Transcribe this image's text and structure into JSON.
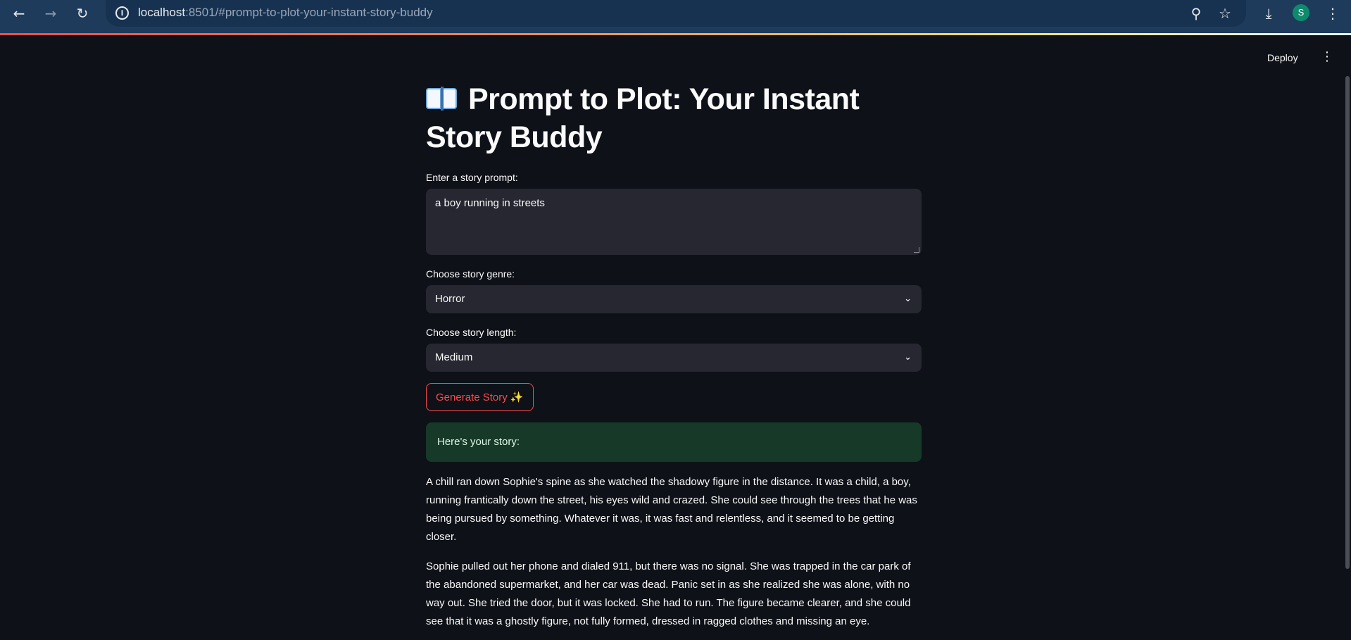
{
  "browser": {
    "url_host": "localhost",
    "url_path": ":8501/#prompt-to-plot-your-instant-story-buddy",
    "profile_initial": "S",
    "icons": [
      "back-arrow-icon",
      "forward-arrow-icon",
      "reload-icon",
      "site-info-icon",
      "zoom-icon",
      "star-icon",
      "download-icon",
      "more-vert-icon"
    ]
  },
  "app_header": {
    "deploy_label": "Deploy"
  },
  "page": {
    "title_line1": "Prompt to Plot: Your Instant",
    "title_line2": "Story Buddy",
    "title_icon": "open-book-icon"
  },
  "form": {
    "prompt_label": "Enter a story prompt:",
    "prompt_value": "a boy running in streets",
    "genre_label": "Choose story genre:",
    "genre_value": "Horror",
    "length_label": "Choose story length:",
    "length_value": "Medium",
    "generate_label": "Generate Story",
    "generate_icon": "sparkles-icon"
  },
  "result": {
    "heading": "Here's your story:",
    "paragraphs": [
      "A chill ran down Sophie's spine as she watched the shadowy figure in the distance. It was a child, a boy, running frantically down the street, his eyes wild and crazed. She could see through the trees that he was being pursued by something. Whatever it was, it was fast and relentless, and it seemed to be getting closer.",
      "Sophie pulled out her phone and dialed 911, but there was no signal. She was trapped in the car park of the abandoned supermarket, and her car was dead. Panic set in as she realized she was alone, with no way out. She tried the door, but it was locked. She had to run. The figure became clearer, and she could see that it was a ghostly figure, not fully formed, dressed in ragged clothes and missing an eye."
    ]
  },
  "colors": {
    "background": "#0e1117",
    "input_bg": "#262730",
    "accent": "#ff4b4b",
    "success_bg": "#173928",
    "chrome_bg": "#1f3b5c"
  }
}
